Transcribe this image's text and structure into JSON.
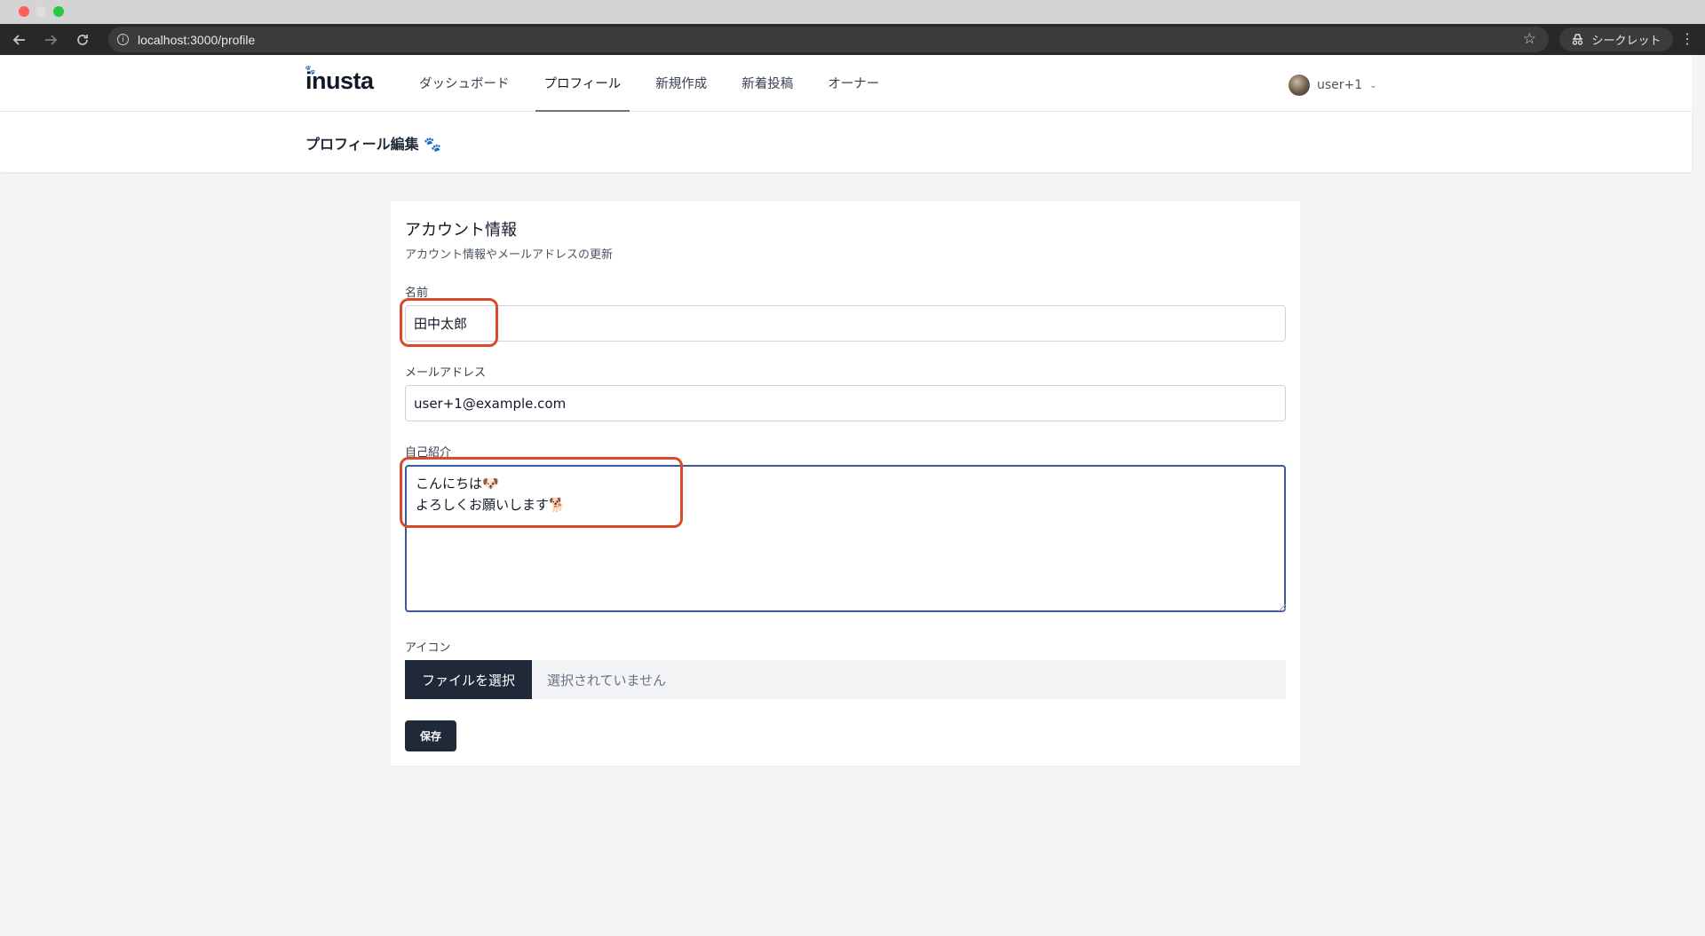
{
  "browser": {
    "url": "localhost:3000/profile",
    "incognito_label": "シークレット",
    "info_icon": "info-icon",
    "bookmark_icon": "star-icon"
  },
  "app": {
    "logo": "inusta",
    "nav": [
      {
        "label": "ダッシュボード",
        "active": false
      },
      {
        "label": "プロフィール",
        "active": true
      },
      {
        "label": "新規作成",
        "active": false
      },
      {
        "label": "新着投稿",
        "active": false
      },
      {
        "label": "オーナー",
        "active": false
      }
    ],
    "user_name": "user+1"
  },
  "page": {
    "title": "プロフィール編集 🐾"
  },
  "form": {
    "section_title": "アカウント情報",
    "section_desc": "アカウント情報やメールアドレスの更新",
    "name_label": "名前",
    "name_value": "田中太郎",
    "email_label": "メールアドレス",
    "email_value": "user+1@example.com",
    "bio_label": "自己紹介",
    "bio_value": "こんにちは🐶\nよろしくお願いします🐕",
    "icon_label": "アイコン",
    "file_button": "ファイルを選択",
    "file_status": "選択されていません",
    "save_label": "保存"
  },
  "colors": {
    "accent_dark": "#1f2937",
    "highlight": "#d94a2b",
    "focus_border": "#3b5998"
  }
}
